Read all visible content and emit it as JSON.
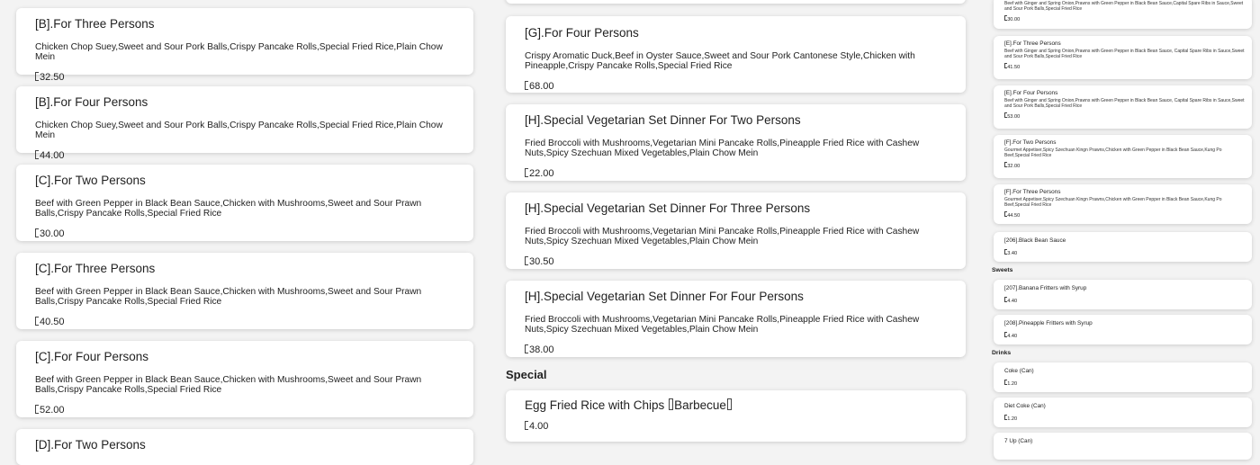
{
  "currency_glyph": "box-glyph",
  "column_a": [
    {
      "title": "[B].For Three Persons",
      "desc": "Chicken Chop Suey,Sweet and Sour Pork Balls,Crispy Pancake Rolls,Special Fried Rice,Plain Chow Mein",
      "price": "32.50"
    },
    {
      "title": "[B].For Four Persons",
      "desc": "Chicken Chop Suey,Sweet and Sour Pork Balls,Crispy Pancake Rolls,Special Fried Rice,Plain Chow Mein",
      "price": "44.00"
    },
    {
      "title": "[C].For Two Persons",
      "desc": "Beef with Green Pepper in Black Bean Sauce,Chicken with Mushrooms,Sweet and Sour Prawn Balls,Crispy Pancake Rolls,Special Fried Rice",
      "price": "30.00"
    },
    {
      "title": "[C].For Three Persons",
      "desc": "Beef with Green Pepper in Black Bean Sauce,Chicken with Mushrooms,Sweet and Sour Prawn Balls,Crispy Pancake Rolls,Special Fried Rice",
      "price": "40.50"
    },
    {
      "title": "[C].For Four Persons",
      "desc": "Beef with Green Pepper in Black Bean Sauce,Chicken with Mushrooms,Sweet and Sour Prawn Balls,Crispy Pancake Rolls,Special Fried Rice",
      "price": "52.00"
    },
    {
      "title": "[D].For Two Persons",
      "desc": "",
      "price": ""
    }
  ],
  "column_b": [
    {
      "title": "",
      "desc": "",
      "price": ""
    },
    {
      "title": "[G].For Four Persons",
      "desc": "Crispy Aromatic Duck,Beef in Oyster Sauce,Sweet and Sour Pork Cantonese Style,Chicken with Pineapple,Crispy Pancake Rolls,Special Fried Rice",
      "price": "68.00"
    },
    {
      "title": "[H].Special Vegetarian Set Dinner For Two Persons",
      "desc": "Fried Broccoli with Mushrooms,Vegetarian Mini Pancake Rolls,Pineapple Fried Rice with Cashew Nuts,Spicy Szechuan Mixed Vegetables,Plain Chow Mein",
      "price": "22.00"
    },
    {
      "title": "[H].Special Vegetarian Set Dinner For Three Persons",
      "desc": "Fried Broccoli with Mushrooms,Vegetarian Mini Pancake Rolls,Pineapple Fried Rice with Cashew Nuts,Spicy Szechuan Mixed Vegetables,Plain Chow Mein",
      "price": "30.50"
    },
    {
      "title": "[H].Special Vegetarian Set Dinner For Four Persons",
      "desc": "Fried Broccoli with Mushrooms,Vegetarian Mini Pancake Rolls,Pineapple Fried Rice with Cashew Nuts,Spicy Szechuan Mixed Vegetables,Plain Chow Mein",
      "price": "38.00"
    }
  ],
  "special_section": "Special",
  "special_item": {
    "title_main": "Egg Fried Rice with Chips ",
    "title_tag": "Barbecue",
    "price": "4.00"
  },
  "column_c": [
    {
      "title": "",
      "desc": "Beef with Ginger and Spring Onion,Prawns with Green Pepper in Black Bean Sauce,Capital Spare Ribs in Sauce,Sweet and Sour Pork Balls,Special Fried Rice",
      "price": "30.00"
    },
    {
      "title": "[E].For Three Persons",
      "desc": "Beef with Ginger and Spring Onion,Prawns with Green Pepper in Black Bean Sauce, Capital Spare Ribs in Sauce,Sweet and Sour Pork Balls,Special Fried Rice",
      "price": "41.50"
    },
    {
      "title": "[E].For Four Persons",
      "desc": "Beef with Ginger and Spring Onion,Prawns with Green Pepper in Black Bean Sauce, Capital Spare Ribs in Sauce,Sweet and Sour Pork Balls,Special Fried Rice",
      "price": "53.00"
    },
    {
      "title": "[F].For Two Persons",
      "desc": "Gourmet Appetiser,Spicy Szechuan Kingn Prawns,Chicken with Green Pepper in Black Bean Sauce,Kung Po Beef,Special Fried Rice",
      "price": "32.00"
    },
    {
      "title": "[F].For Three Persons",
      "desc": "Gourmet Appetiser,Spicy Szechuan Kingn Prawns,Chicken with Green Pepper in Black Bean Sauce,Kung Po Beef,Special Fried Rice",
      "price": "44.50"
    },
    {
      "title": "[206].Black Bean Sauce",
      "desc": "",
      "price": "3.40"
    }
  ],
  "sweets_section": "Sweets",
  "sweets": [
    {
      "title": "[207].Banana Fritters with Syrup",
      "price": "4.40"
    },
    {
      "title": "[208].Pineapple Fritters with Syrup",
      "price": "4.40"
    }
  ],
  "drinks_section": "Drinks",
  "drinks": [
    {
      "title": "Coke (Can)",
      "price": "1.20"
    },
    {
      "title": "Diet Coke (Can)",
      "price": "1.20"
    },
    {
      "title": "7 Up (Can)",
      "price": ""
    }
  ]
}
